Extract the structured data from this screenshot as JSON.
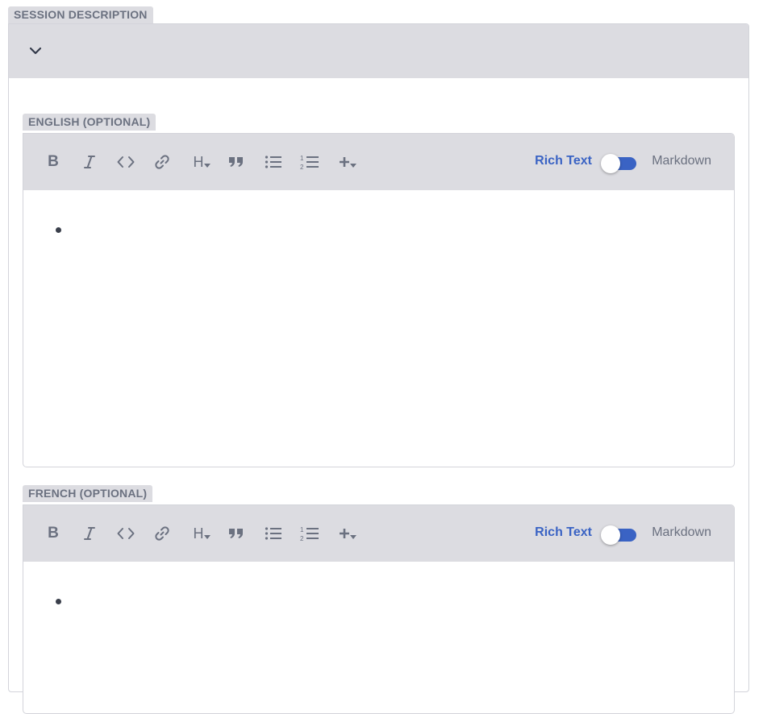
{
  "session": {
    "label": "SESSION DESCRIPTION"
  },
  "editors": [
    {
      "label": "ENGLISH (OPTIONAL)",
      "mode_rich": "Rich Text",
      "mode_markdown": "Markdown",
      "toolbar": {
        "bold": "B",
        "heading": "H"
      }
    },
    {
      "label": "FRENCH (OPTIONAL)",
      "mode_rich": "Rich Text",
      "mode_markdown": "Markdown",
      "toolbar": {
        "bold": "B",
        "heading": "H"
      }
    }
  ],
  "icons": [
    "chevron-down-icon",
    "bold-icon",
    "italic-icon",
    "code-icon",
    "link-icon",
    "heading-icon",
    "quote-icon",
    "bulleted-list-icon",
    "numbered-list-icon",
    "add-icon"
  ],
  "colors": {
    "accent": "#3a63c4",
    "panel": "#dcdce1",
    "muted_text": "#6b7180"
  }
}
